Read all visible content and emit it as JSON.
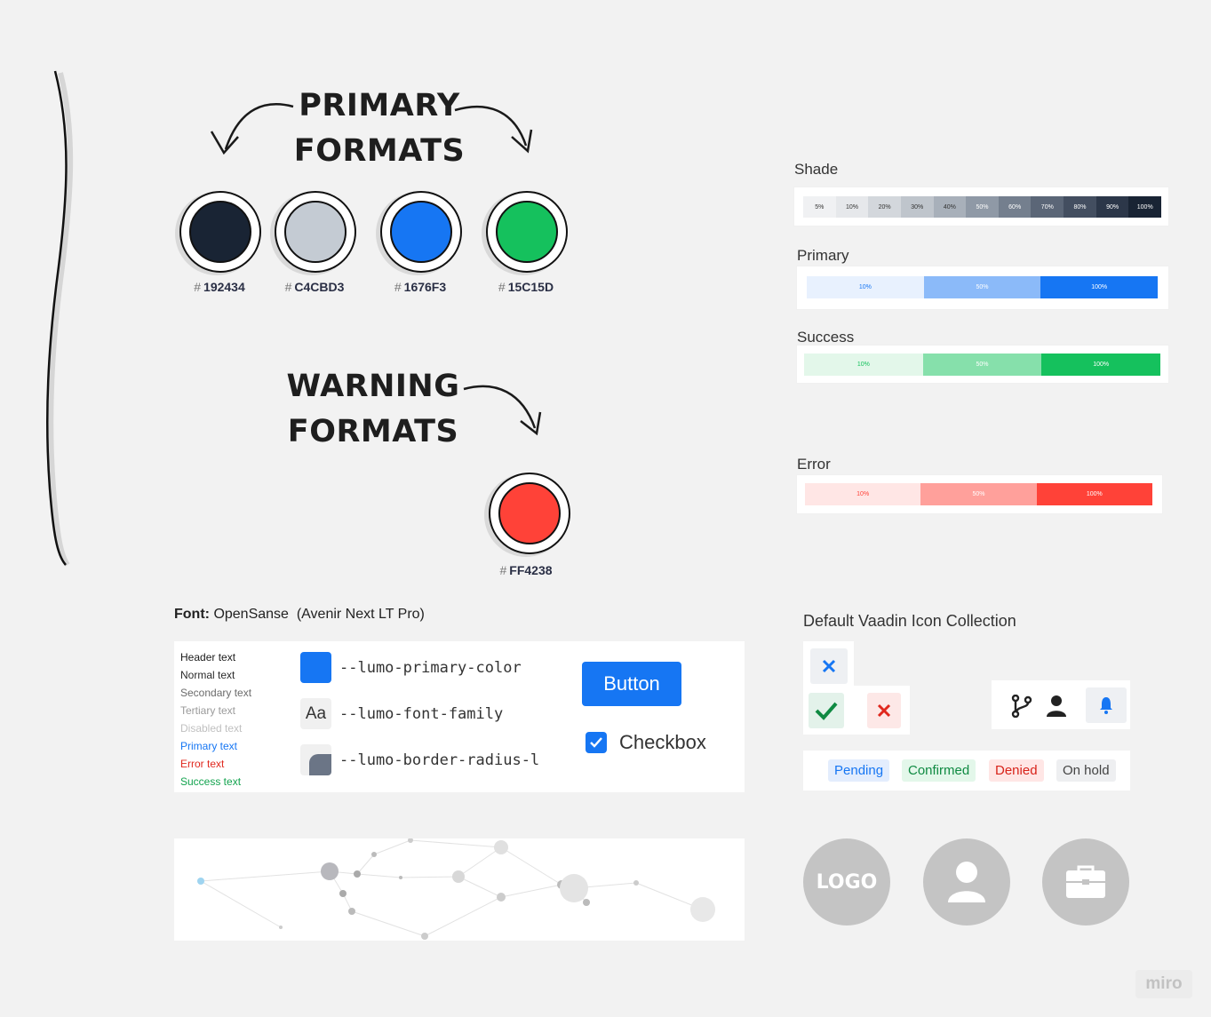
{
  "headings": {
    "primary_line1": "PRIMARY",
    "primary_line2": "FORMATS",
    "warning_line1": "WARNING",
    "warning_line2": "FORMATS"
  },
  "primary_swatches": [
    {
      "hash": "#",
      "code": "192434",
      "color": "#192434"
    },
    {
      "hash": "#",
      "code": "C4CBD3",
      "color": "#C4CBD3"
    },
    {
      "hash": "#",
      "code": "1676F3",
      "color": "#1676F3"
    },
    {
      "hash": "#",
      "code": "15C15D",
      "color": "#15C15D"
    }
  ],
  "warning_swatch": {
    "hash": "#",
    "code": "FF4238",
    "color": "#FF4238"
  },
  "scales": {
    "shade": {
      "label": "Shade",
      "cells": [
        {
          "text": "5%",
          "bg": "#f0f1f3",
          "fg": "#333"
        },
        {
          "text": "10%",
          "bg": "#e6e8eb",
          "fg": "#333"
        },
        {
          "text": "20%",
          "bg": "#d3d7dc",
          "fg": "#333"
        },
        {
          "text": "30%",
          "bg": "#bfc5cc",
          "fg": "#333"
        },
        {
          "text": "40%",
          "bg": "#a8b0ba",
          "fg": "#333"
        },
        {
          "text": "50%",
          "bg": "#8f99a6",
          "fg": "#fff"
        },
        {
          "text": "60%",
          "bg": "#747f8e",
          "fg": "#fff"
        },
        {
          "text": "70%",
          "bg": "#5b6677",
          "fg": "#fff"
        },
        {
          "text": "80%",
          "bg": "#434e60",
          "fg": "#fff"
        },
        {
          "text": "90%",
          "bg": "#2c3749",
          "fg": "#fff"
        },
        {
          "text": "100%",
          "bg": "#192434",
          "fg": "#fff"
        }
      ]
    },
    "primary": {
      "label": "Primary",
      "cells": [
        {
          "text": "10%",
          "bg": "#e8f1fe",
          "fg": "#1676f3"
        },
        {
          "text": "50%",
          "bg": "#8bbaf9",
          "fg": "#fff"
        },
        {
          "text": "100%",
          "bg": "#1676f3",
          "fg": "#fff"
        }
      ]
    },
    "success": {
      "label": "Success",
      "cells": [
        {
          "text": "10%",
          "bg": "#e3f7ea",
          "fg": "#15c15d"
        },
        {
          "text": "50%",
          "bg": "#86e0ab",
          "fg": "#fff"
        },
        {
          "text": "100%",
          "bg": "#15c15d",
          "fg": "#fff"
        }
      ]
    },
    "error": {
      "label": "Error",
      "cells": [
        {
          "text": "10%",
          "bg": "#ffe6e5",
          "fg": "#ff4238"
        },
        {
          "text": "50%",
          "bg": "#ffa09b",
          "fg": "#fff"
        },
        {
          "text": "100%",
          "bg": "#ff4238",
          "fg": "#fff"
        }
      ]
    }
  },
  "font_info": {
    "label": "Font:",
    "value": "OpenSanse  (Avenir Next LT Pro)"
  },
  "text_styles": [
    {
      "text": "Header text",
      "color": "#1a1a1a"
    },
    {
      "text": "Normal text",
      "color": "#2a2a2a"
    },
    {
      "text": "Secondary text",
      "color": "#6b6b6b"
    },
    {
      "text": "Tertiary text",
      "color": "#9a9a9a"
    },
    {
      "text": "Disabled text",
      "color": "#c0c0c0"
    },
    {
      "text": "Primary text",
      "color": "#1676f3"
    },
    {
      "text": "Error text",
      "color": "#e0281e"
    },
    {
      "text": "Success text",
      "color": "#12a34e"
    }
  ],
  "lumo_vars": [
    {
      "name": "--lumo-primary-color",
      "icon": "primary-color-swatch-icon"
    },
    {
      "name": "--lumo-font-family",
      "icon": "font-family-icon",
      "glyph": "Aa"
    },
    {
      "name": "--lumo-border-radius-l",
      "icon": "border-radius-icon"
    }
  ],
  "button": {
    "label": "Button"
  },
  "checkbox": {
    "label": "Checkbox",
    "checked": true
  },
  "icons": {
    "title": "Default Vaadin Icon Collection"
  },
  "badges": [
    {
      "text": "Pending",
      "bg": "#e3edfd",
      "fg": "#1676f3"
    },
    {
      "text": "Confirmed",
      "bg": "#e3f7ea",
      "fg": "#0f8a42"
    },
    {
      "text": "Denied",
      "bg": "#ffe6e5",
      "fg": "#d8231a"
    },
    {
      "text": "On hold",
      "bg": "#eeeff1",
      "fg": "#444"
    }
  ],
  "avatars": {
    "logo_text": "LOGO"
  },
  "watermark": "miro"
}
